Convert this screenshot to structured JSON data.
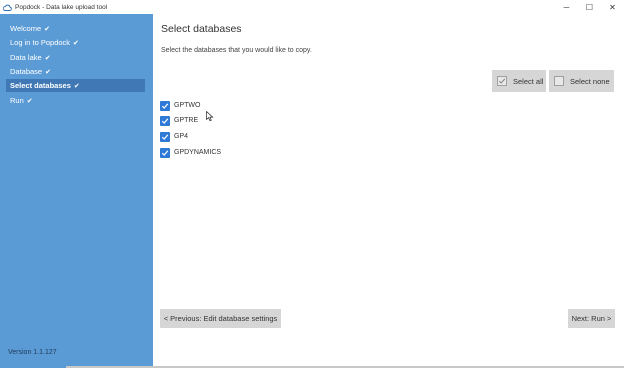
{
  "window": {
    "title": "Popdock - Data lake upload tool",
    "minimize_glyph": "─",
    "maximize_glyph": "☐",
    "close_glyph": "✕"
  },
  "sidebar": {
    "items": [
      {
        "label": "Welcome",
        "check": "✔",
        "active": false
      },
      {
        "label": "Log in to Popdock",
        "check": "✔",
        "active": false
      },
      {
        "label": "Data lake",
        "check": "✔",
        "active": false
      },
      {
        "label": "Database",
        "check": "✔",
        "active": false
      },
      {
        "label": "Select databases",
        "check": "✔",
        "active": true
      },
      {
        "label": "Run",
        "check": "✔",
        "active": false
      }
    ],
    "version": "Version 1.1.127"
  },
  "main": {
    "title": "Select databases",
    "instruction": "Select the databases that you would like to copy.",
    "select_all_label": "Select all",
    "select_none_label": "Select none",
    "databases": [
      {
        "name": "GPTWO",
        "checked": true
      },
      {
        "name": "GPTRE",
        "checked": true
      },
      {
        "name": "GP4",
        "checked": true
      },
      {
        "name": "GPDYNAMICS",
        "checked": true
      }
    ],
    "prev_button": "< Previous: Edit database settings",
    "next_button": "Next: Run >"
  },
  "colors": {
    "sidebar": "#5b9bd5",
    "sidebar_active": "#3f78b5",
    "checkbox": "#2f7ad6",
    "button": "#d6d6d6"
  }
}
